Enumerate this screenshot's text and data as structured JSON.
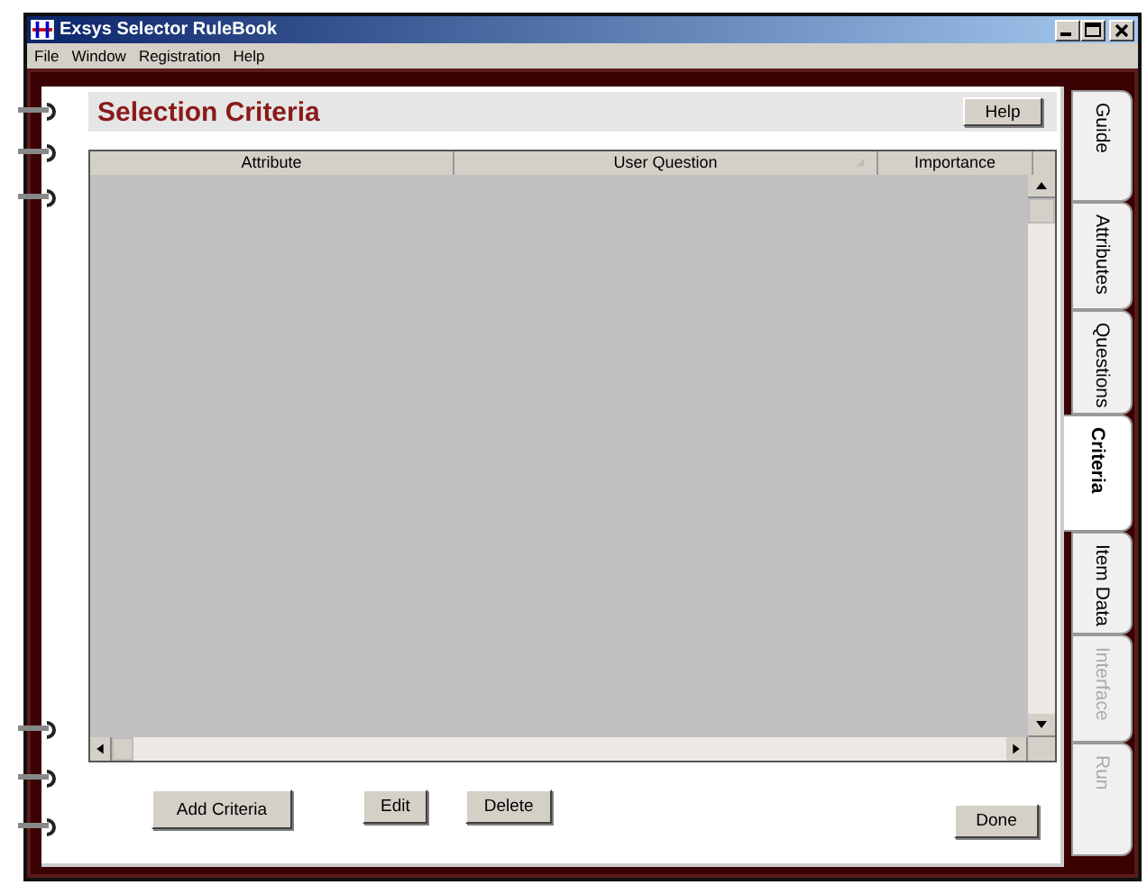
{
  "window": {
    "title": "Exsys Selector RuleBook"
  },
  "menu": [
    {
      "label": "File"
    },
    {
      "label": "Window"
    },
    {
      "label": "Registration"
    },
    {
      "label": "Help"
    }
  ],
  "page": {
    "title": "Selection Criteria",
    "help_button": "Help"
  },
  "table": {
    "columns": [
      {
        "label": "Attribute",
        "sortable": false
      },
      {
        "label": "User Question",
        "sortable": true
      },
      {
        "label": "Importance",
        "sortable": false
      }
    ]
  },
  "buttons": [
    {
      "label": "Add Criteria",
      "kind": "wide"
    },
    {
      "label": "Edit",
      "kind": "small"
    },
    {
      "label": "Delete",
      "kind": "small"
    },
    {
      "label": "Done",
      "kind": "done"
    }
  ],
  "tabs": [
    {
      "label": "Guide",
      "selected": false,
      "disabled": false
    },
    {
      "label": "Attributes",
      "selected": false,
      "disabled": false
    },
    {
      "label": "Questions",
      "selected": false,
      "disabled": false
    },
    {
      "label": "Criteria",
      "selected": true,
      "disabled": false
    },
    {
      "label": "Item Data",
      "selected": false,
      "disabled": false
    },
    {
      "label": "Interface",
      "selected": false,
      "disabled": true
    },
    {
      "label": "Run",
      "selected": false,
      "disabled": true
    }
  ]
}
